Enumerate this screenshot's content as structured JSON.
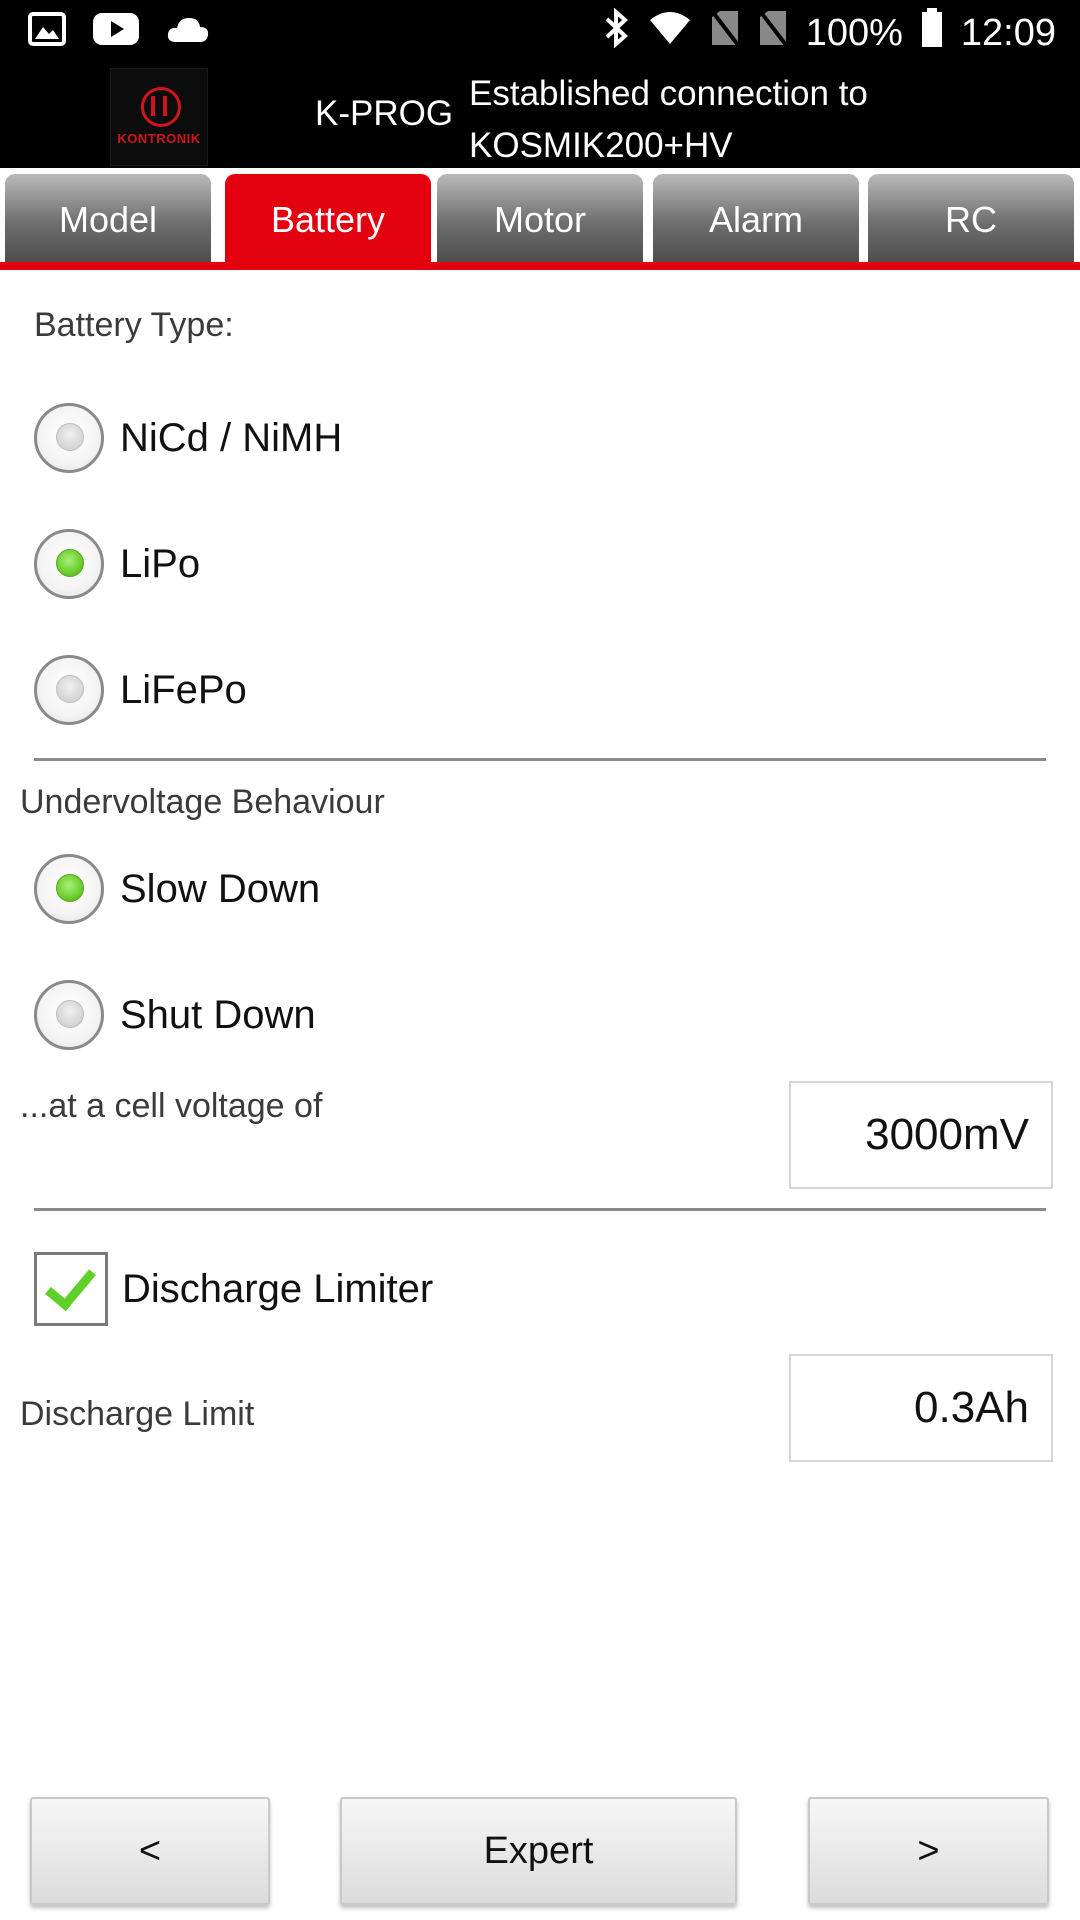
{
  "status_bar": {
    "battery_percent": "100%",
    "time": "12:09",
    "left_icons": [
      "image-icon",
      "youtube-icon",
      "cloud-icon"
    ],
    "right_icons": [
      "bluetooth-icon",
      "wifi-icon",
      "no-sim-icon",
      "no-sim-icon",
      "battery-icon"
    ]
  },
  "header": {
    "logo_text": "KONTRONIK",
    "app_name": "K-PROG",
    "connection_line1": "Established connection to",
    "connection_line2": "KOSMIK200+HV"
  },
  "tabs": [
    {
      "label": "Model",
      "active": false
    },
    {
      "label": "Battery",
      "active": true
    },
    {
      "label": "Motor",
      "active": false
    },
    {
      "label": "Alarm",
      "active": false
    },
    {
      "label": "RC",
      "active": false
    }
  ],
  "battery_type": {
    "label": "Battery Type:",
    "options": [
      {
        "label": "NiCd / NiMH",
        "checked": false
      },
      {
        "label": "LiPo",
        "checked": true
      },
      {
        "label": "LiFePo",
        "checked": false
      }
    ]
  },
  "undervoltage": {
    "label": "Undervoltage Behaviour",
    "options": [
      {
        "label": "Slow Down",
        "checked": true
      },
      {
        "label": "Shut Down",
        "checked": false
      }
    ],
    "cell_voltage_label": "...at a cell voltage of",
    "cell_voltage_value": "3000mV"
  },
  "discharge": {
    "limiter_label": "Discharge Limiter",
    "limiter_checked": true,
    "limit_label": "Discharge Limit",
    "limit_value": "0.3Ah"
  },
  "buttons": {
    "prev": "<",
    "expert": "Expert",
    "next": ">"
  },
  "colors": {
    "accent_red": "#e3000f",
    "radio_green": "#6ccd2b"
  }
}
